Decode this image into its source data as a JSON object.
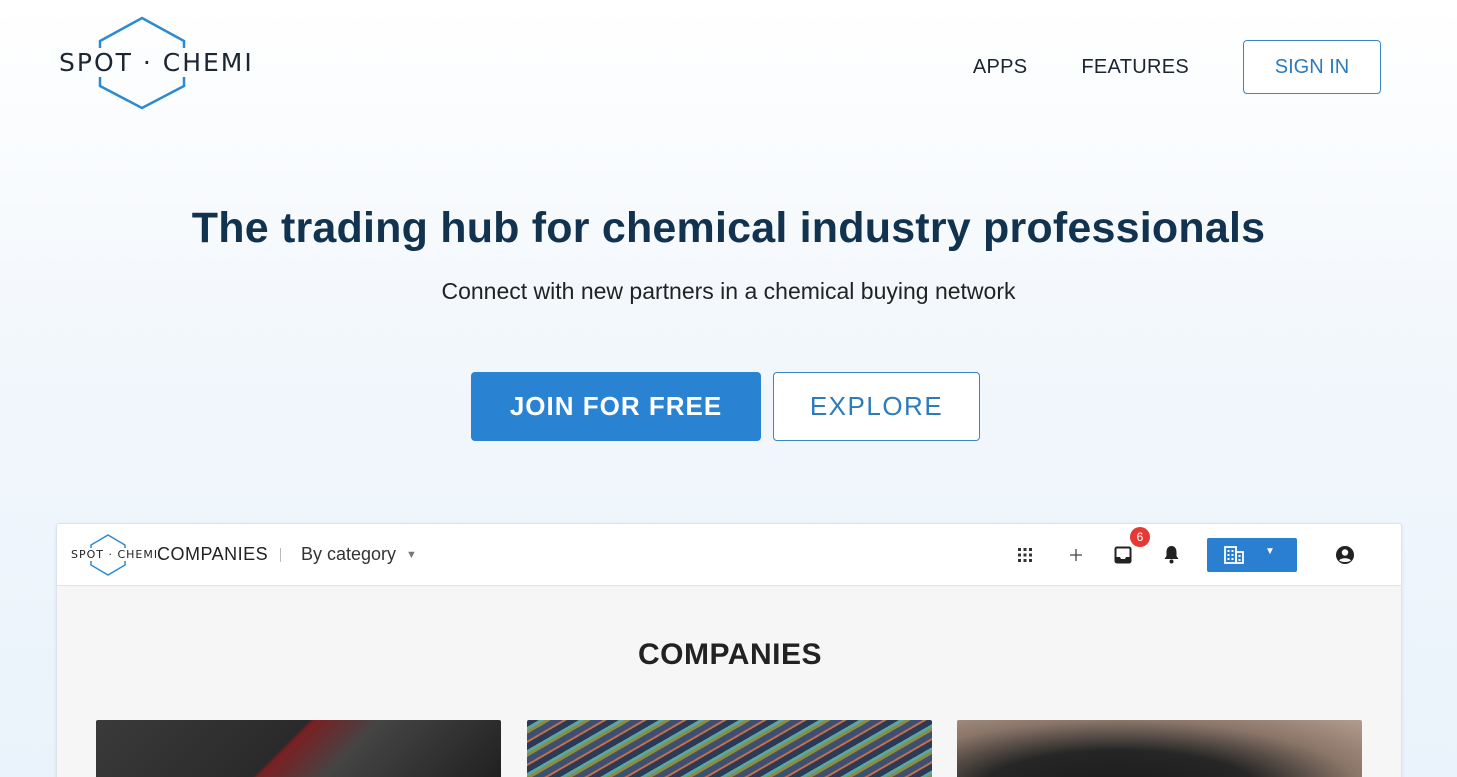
{
  "header": {
    "logo_text": "SPOT · CHEMI",
    "nav": [
      {
        "label": "APPS"
      },
      {
        "label": "FEATURES"
      }
    ],
    "sign_in_label": "SIGN IN"
  },
  "hero": {
    "title": "The trading hub for chemical industry professionals",
    "subtitle": "Connect with new partners in a chemical buying network",
    "join_label": "JOIN FOR FREE",
    "explore_label": "EXPLORE"
  },
  "preview": {
    "logo_text": "SPOT · CHEMI",
    "section_label": "COMPANIES",
    "filter_label": "By category",
    "notification_count": "6",
    "heading": "COMPANIES",
    "icons": [
      "apps-grid-icon",
      "plus-icon",
      "inbox-icon",
      "bell-icon",
      "building-icon",
      "account-icon"
    ]
  },
  "colors": {
    "primary": "#2a83d2",
    "title": "#12334f",
    "badge": "#e53935"
  }
}
